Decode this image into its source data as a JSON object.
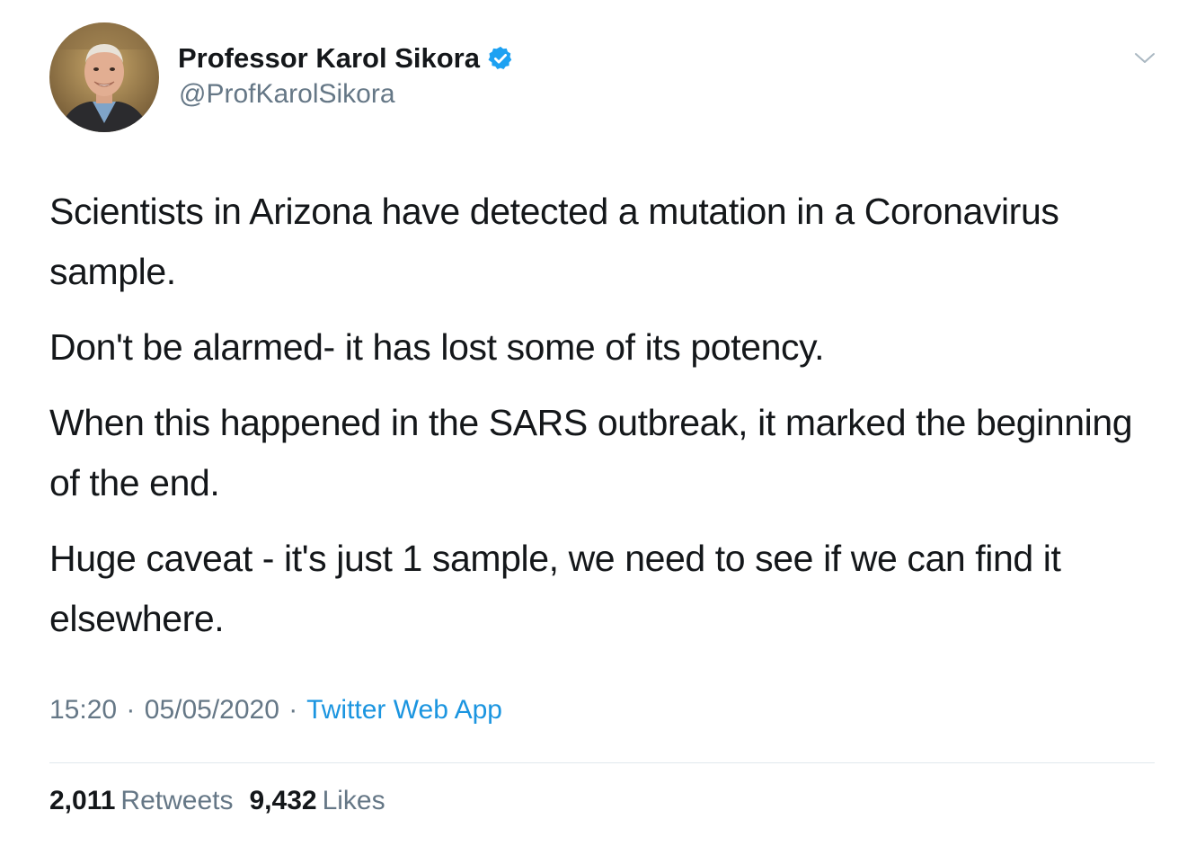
{
  "author": {
    "name": "Professor Karol Sikora",
    "handle": "@ProfKarolSikora",
    "verified": true
  },
  "tweet": {
    "paragraphs": [
      "Scientists in Arizona have detected a mutation in a Coronavirus sample.",
      "Don't be alarmed- it has lost some of its potency.",
      "When this happened in the SARS outbreak, it marked the beginning of the end.",
      "Huge caveat - it's just 1 sample, we need to see if we can find it elsewhere."
    ],
    "time": "15:20",
    "date": "05/05/2020",
    "separator": "·",
    "source": "Twitter Web App"
  },
  "stats": {
    "retweets_count": "2,011",
    "retweets_label": "Retweets",
    "likes_count": "9,432",
    "likes_label": "Likes"
  },
  "colors": {
    "accent": "#1b95e0",
    "muted": "#657786",
    "text": "#14171a",
    "divider": "#e1e8ed"
  },
  "icons": {
    "verified": "verified-badge-icon",
    "menu": "chevron-down-icon"
  }
}
